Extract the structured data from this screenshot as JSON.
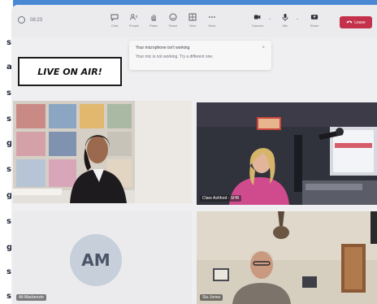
{
  "margin_text": {
    "letters": [
      "s",
      "a",
      "s",
      "s",
      "g",
      "s",
      "g",
      "s",
      "g",
      "s",
      "s"
    ]
  },
  "toolbar": {
    "time": "08:23",
    "buttons": [
      {
        "label": "Chat",
        "icon": "chat-icon"
      },
      {
        "label": "People",
        "icon": "people-icon"
      },
      {
        "label": "Raise",
        "icon": "raise-hand-icon"
      },
      {
        "label": "React",
        "icon": "react-icon"
      },
      {
        "label": "View",
        "icon": "view-icon"
      },
      {
        "label": "More",
        "icon": "more-icon"
      },
      {
        "label": "Camera",
        "icon": "camera-icon"
      },
      {
        "label": "Mic",
        "icon": "mic-icon"
      },
      {
        "label": "Share",
        "icon": "share-icon"
      }
    ],
    "leave_label": "Leave",
    "leave_color": "#c4314b"
  },
  "tooltip": {
    "title": "Your microphone isn't working",
    "body": "Your mic is not working. Try a different one.",
    "close": "×"
  },
  "banner": {
    "text": "LIVE ON AIR!"
  },
  "tiles": [
    {
      "name": "",
      "kind": "video"
    },
    {
      "name": "Clare Ashford - SHR",
      "kind": "video"
    },
    {
      "name": "Ali Mackenzie",
      "initials": "AM",
      "kind": "avatar"
    },
    {
      "name": "Stu Jones",
      "kind": "video"
    }
  ],
  "colors": {
    "frame": "#4a88d6",
    "screen": "#efeff2",
    "avatar_bg": "#c6cfda"
  }
}
